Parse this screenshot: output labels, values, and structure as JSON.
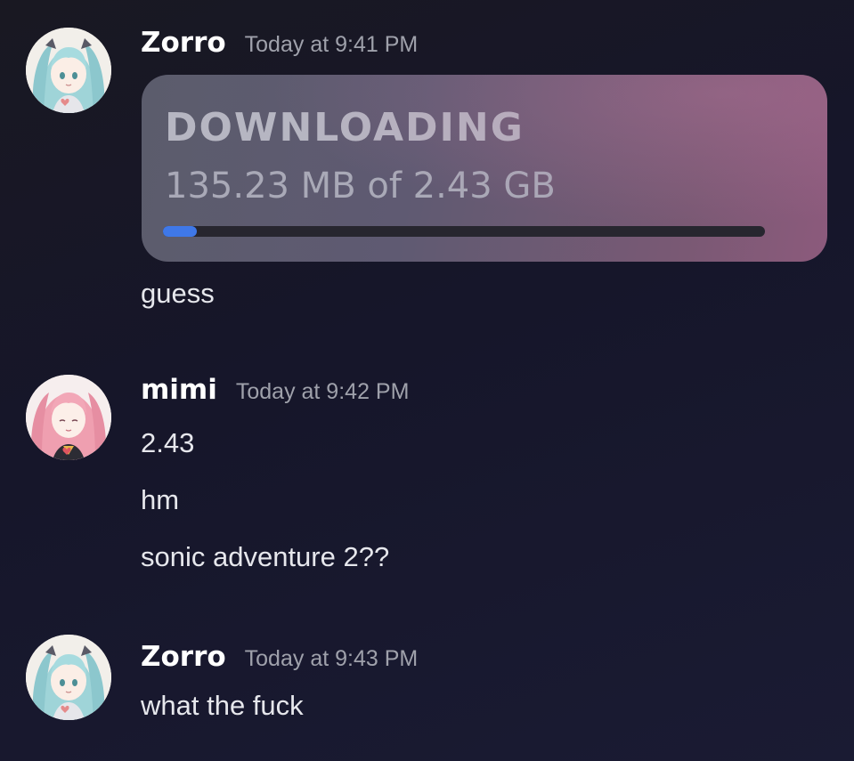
{
  "messages": [
    {
      "author": "Zorro",
      "timestamp": "Today at 9:41 PM",
      "embed": {
        "title": "DOWNLOADING",
        "size_text": "135.23 MB of 2.43 GB",
        "progress_fraction": 0.056
      },
      "lines": [
        "guess"
      ]
    },
    {
      "author": "mimi",
      "timestamp": "Today at 9:42 PM",
      "lines": [
        "2.43",
        "hm",
        "sonic adventure 2??"
      ]
    },
    {
      "author": "Zorro",
      "timestamp": "Today at 9:43 PM",
      "lines": [
        "what the fuck"
      ]
    }
  ],
  "colors": {
    "progress_fill": "#3f78e8",
    "username": "#ffffff",
    "timestamp": "#9fa1ab"
  },
  "icons": {
    "zorro_avatar": "anime-girl-teal-hair-avatar",
    "mimi_avatar": "anime-girl-pink-hair-avatar"
  }
}
